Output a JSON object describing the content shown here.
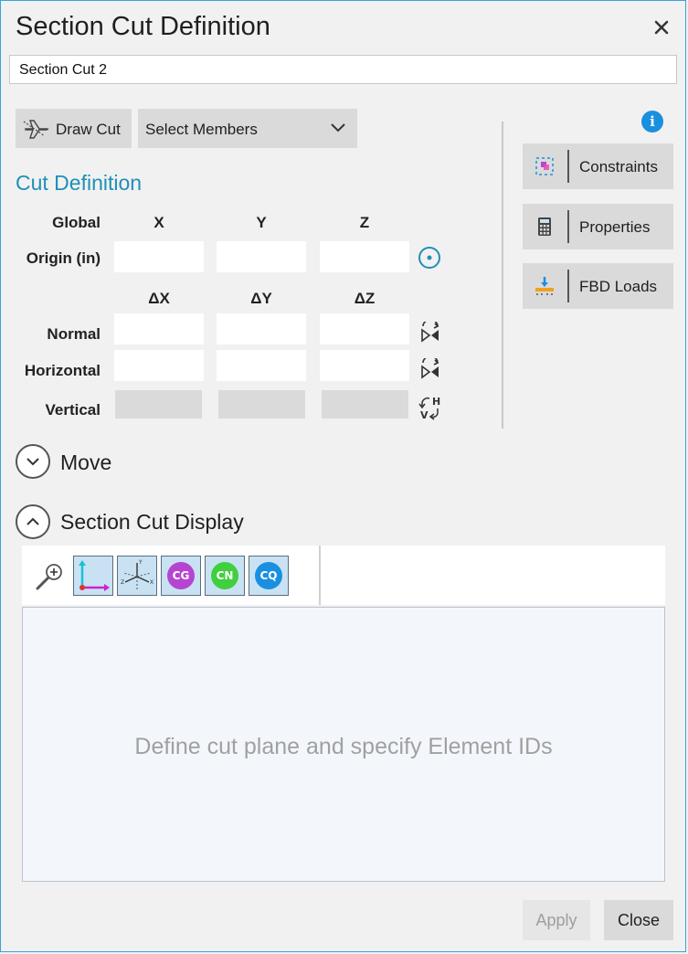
{
  "window": {
    "title": "Section Cut Definition",
    "close_icon": "close-icon"
  },
  "name_field": {
    "value": "Section Cut 2"
  },
  "toolbar": {
    "draw_cut_label": "Draw Cut",
    "select_members_label": "Select Members"
  },
  "cut_definition": {
    "heading": "Cut Definition",
    "global_label": "Global",
    "axis_headers": [
      "X",
      "Y",
      "Z"
    ],
    "delta_headers": [
      "ΔX",
      "ΔY",
      "ΔZ"
    ],
    "origin_label": "Origin  (in)",
    "normal_label": "Normal",
    "horizontal_label": "Horizontal",
    "vertical_label": "Vertical",
    "origin": {
      "x": "",
      "y": "",
      "z": ""
    },
    "normal": {
      "x": "",
      "y": "",
      "z": ""
    },
    "horizontal": {
      "x": "",
      "y": "",
      "z": ""
    },
    "vertical": {
      "x": "",
      "y": "",
      "z": ""
    }
  },
  "side_buttons": [
    {
      "label": "Constraints",
      "icon": "constraints-icon"
    },
    {
      "label": "Properties",
      "icon": "calculator-icon"
    },
    {
      "label": "FBD Loads",
      "icon": "fbd-loads-icon"
    }
  ],
  "move": {
    "label": "Move",
    "expanded": false
  },
  "display": {
    "label": "Section Cut Display",
    "expanded": true,
    "tools": [
      {
        "name": "zoom-icon",
        "active": false
      },
      {
        "name": "axis-2d-icon",
        "active": true
      },
      {
        "name": "axis-3d-icon",
        "active": true
      },
      {
        "name": "cg-icon",
        "text": "CG",
        "color": "#b545d0",
        "active": true
      },
      {
        "name": "cn-icon",
        "text": "CN",
        "color": "#3fcf3f",
        "active": true
      },
      {
        "name": "cq-icon",
        "text": "CQ",
        "color": "#1a8fe0",
        "active": true
      }
    ],
    "placeholder": "Define cut plane and specify Element IDs"
  },
  "footer": {
    "apply_label": "Apply",
    "close_label": "Close"
  },
  "colors": {
    "accent": "#1f8fb8",
    "frame": "#3aa3d8"
  }
}
